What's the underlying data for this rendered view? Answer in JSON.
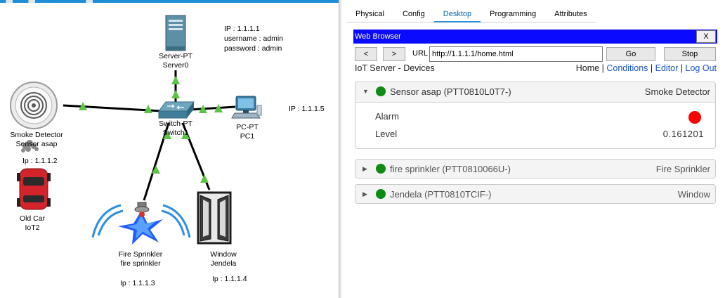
{
  "topology": {
    "devices": {
      "server": {
        "label1": "Server-PT",
        "label2": "Server0"
      },
      "switch": {
        "label1": "Switch-PT",
        "label2": "Switch1"
      },
      "pc": {
        "label1": "PC-PT",
        "label2": "PC1"
      },
      "smoke": {
        "label1": "Smoke Detector",
        "label2": "Sensor asap"
      },
      "car": {
        "label1": "Old Car",
        "label2": "IoT2"
      },
      "sprinkler": {
        "label1": "Fire Sprinkler",
        "label2": "fire sprinkler"
      },
      "window": {
        "label1": "Window",
        "label2": "Jendela"
      }
    },
    "notes": {
      "server_ip": "IP : 1.1.1.1",
      "server_user": "username  : admin",
      "server_pass": "password : admin",
      "pc_ip": "IP : 1.1.1.5",
      "smoke_ip": "Ip : 1.1.1.2",
      "sprinkler_ip": "Ip : 1.1.1.3",
      "window_ip": "Ip : 1.1.1.4"
    },
    "link_color": "#000000",
    "link_light_color": "#5cc444"
  },
  "tabs": [
    "Physical",
    "Config",
    "Desktop",
    "Programming",
    "Attributes"
  ],
  "active_tab": "Desktop",
  "browser": {
    "title": "Web Browser",
    "close": "X",
    "back": "<",
    "forward": ">",
    "url_label": "URL",
    "url": "http://1.1.1.1/home.html",
    "go": "Go",
    "stop": "Stop",
    "title_bar_color": "#0a0aff"
  },
  "page": {
    "title": "IoT Server - Devices",
    "links": {
      "home": "Home",
      "conditions": "Conditions",
      "editor": "Editor",
      "logout": "Log Out",
      "separator": "|"
    }
  },
  "devices": [
    {
      "name": "Sensor asap (PTT0810L0T7-)",
      "type": "Smoke Detector",
      "status_color": "#0f8a14",
      "expanded": true,
      "fields": {
        "alarm_label": "Alarm",
        "alarm_color": "#ff0000",
        "level_label": "Level",
        "level_value": "0.161201"
      }
    },
    {
      "name": "fire sprinkler (PTT0810066U-)",
      "type": "Fire Sprinkler",
      "status_color": "#0f8a14",
      "expanded": false
    },
    {
      "name": "Jendela (PTT0810TCIF-)",
      "type": "Window",
      "status_color": "#0f8a14",
      "expanded": false
    }
  ]
}
